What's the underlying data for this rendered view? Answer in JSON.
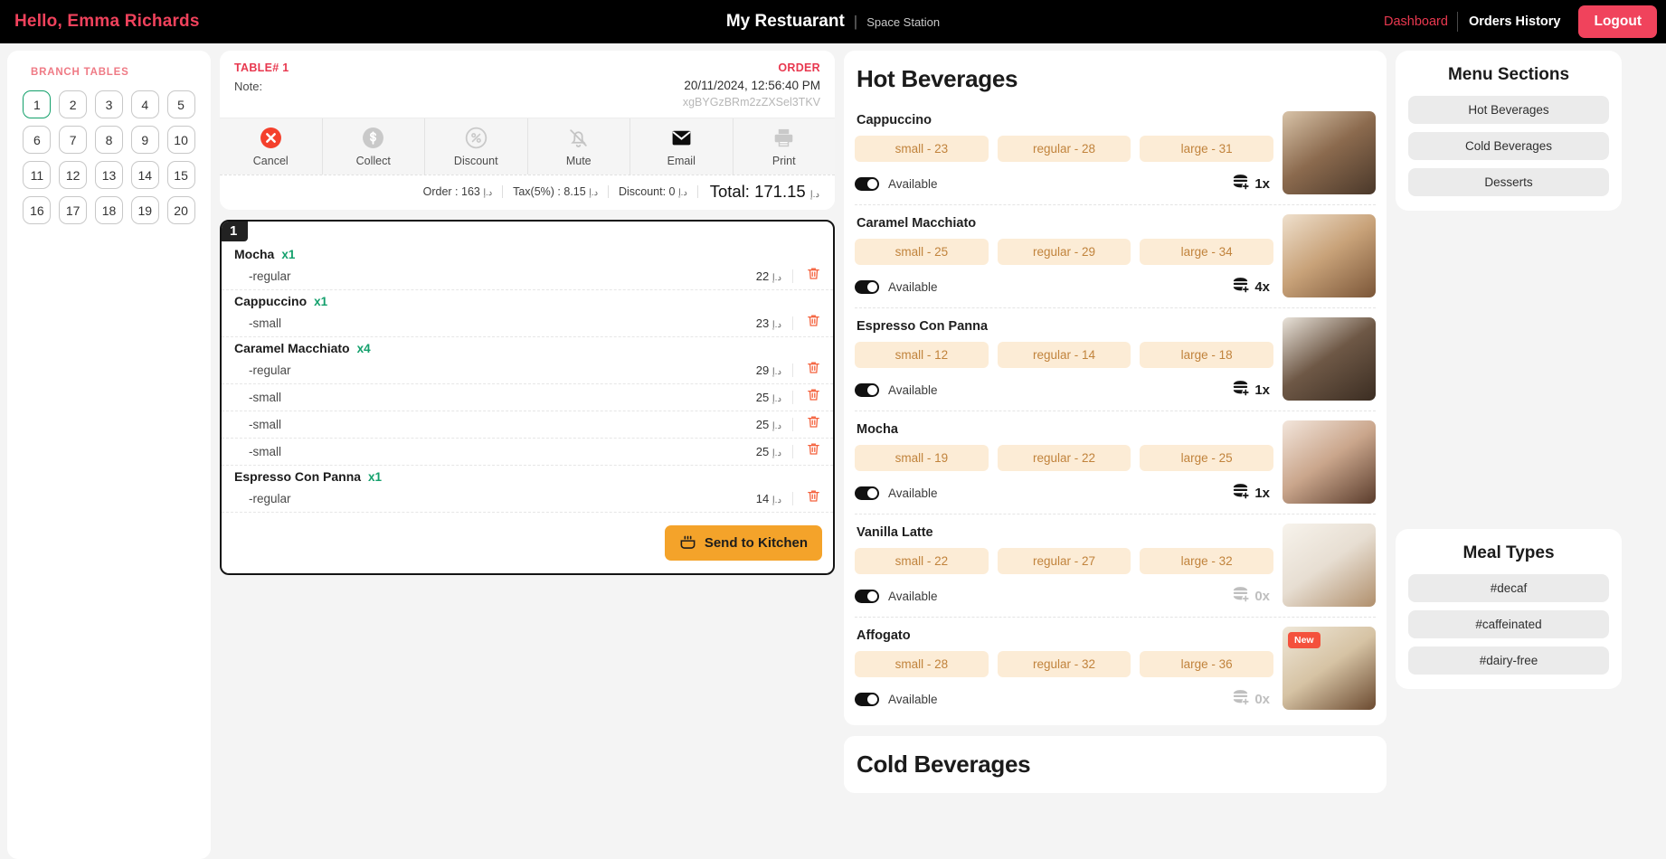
{
  "header": {
    "greeting": "Hello, Emma Richards",
    "brand_name": "My Restuarant",
    "brand_separator": "|",
    "branch": "Space Station",
    "nav_dashboard": "Dashboard",
    "nav_orders_history": "Orders History",
    "logout": "Logout",
    "accent_red": "#f0435c",
    "bar_background": "#000000"
  },
  "branch_tables": {
    "title": "BRANCH TABLES",
    "active_table": "1",
    "tables": [
      "1",
      "2",
      "3",
      "4",
      "5",
      "6",
      "7",
      "8",
      "9",
      "10",
      "11",
      "12",
      "13",
      "14",
      "15",
      "16",
      "17",
      "18",
      "19",
      "20"
    ],
    "active_border_color": "#12a06a"
  },
  "order": {
    "table_label": "TABLE# 1",
    "note_label": "Note:",
    "order_label": "ORDER",
    "datetime": "20/11/2024, 12:56:40 PM",
    "order_id": "xgBYGzBRm2zZXSel3TKV",
    "toolbar": [
      {
        "label": "Cancel",
        "icon": "cancel-circle-icon"
      },
      {
        "label": "Collect",
        "icon": "dollar-circle-icon"
      },
      {
        "label": "Discount",
        "icon": "percent-circle-icon"
      },
      {
        "label": "Mute",
        "icon": "bell-off-icon"
      },
      {
        "label": "Email",
        "icon": "envelope-icon"
      },
      {
        "label": "Print",
        "icon": "printer-icon"
      }
    ],
    "totals": {
      "order": "Order : 163",
      "tax": "Tax(5%) : 8.15",
      "discount": "Discount: 0",
      "total": "Total: 171.15",
      "currency": "د.إ"
    }
  },
  "ticket": {
    "number": "1",
    "send_button": "Send to Kitchen",
    "currency": "د.إ",
    "groups": [
      {
        "name": "Mocha",
        "qty": "x1",
        "options": [
          {
            "name": "-regular",
            "price": "22"
          }
        ]
      },
      {
        "name": "Cappuccino",
        "qty": "x1",
        "options": [
          {
            "name": "-small",
            "price": "23"
          }
        ]
      },
      {
        "name": "Caramel Macchiato",
        "qty": "x4",
        "options": [
          {
            "name": "-regular",
            "price": "29"
          },
          {
            "name": "-small",
            "price": "25"
          },
          {
            "name": "-small",
            "price": "25"
          },
          {
            "name": "-small",
            "price": "25"
          }
        ]
      },
      {
        "name": "Espresso Con Panna",
        "qty": "x1",
        "options": [
          {
            "name": "-regular",
            "price": "14"
          }
        ]
      }
    ]
  },
  "menu": {
    "sections": [
      {
        "title": "Hot Beverages",
        "items": [
          {
            "name": "Cappuccino",
            "sizes": [
              "small - 23",
              "regular - 28",
              "large - 31"
            ],
            "available_label": "Available",
            "available": true,
            "count": "1x",
            "new": false,
            "thumb_colors": [
              "#8b6a4e",
              "#d8c3a8",
              "#4a382a"
            ]
          },
          {
            "name": "Caramel Macchiato",
            "sizes": [
              "small - 25",
              "regular - 29",
              "large - 34"
            ],
            "available_label": "Available",
            "available": true,
            "count": "4x",
            "new": false,
            "thumb_colors": [
              "#c8a279",
              "#efe0cd",
              "#7b5638"
            ]
          },
          {
            "name": "Espresso Con Panna",
            "sizes": [
              "small - 12",
              "regular - 14",
              "large - 18"
            ],
            "available_label": "Available",
            "available": true,
            "count": "1x",
            "new": false,
            "thumb_colors": [
              "#6e5846",
              "#e9e3da",
              "#3b2d22"
            ]
          },
          {
            "name": "Mocha",
            "sizes": [
              "small - 19",
              "regular - 22",
              "large - 25"
            ],
            "available_label": "Available",
            "available": true,
            "count": "1x",
            "new": false,
            "thumb_colors": [
              "#caa68c",
              "#f3e6dc",
              "#5a3c2c"
            ]
          },
          {
            "name": "Vanilla Latte",
            "sizes": [
              "small - 22",
              "regular - 27",
              "large - 32"
            ],
            "available_label": "Available",
            "available": true,
            "count": "0x",
            "new": false,
            "thumb_colors": [
              "#e7ded2",
              "#f7f3ec",
              "#b08f6c"
            ]
          },
          {
            "name": "Affogato",
            "sizes": [
              "small - 28",
              "regular - 32",
              "large - 36"
            ],
            "available_label": "Available",
            "available": true,
            "count": "0x",
            "new": true,
            "new_badge": "New",
            "thumb_colors": [
              "#d6c3a4",
              "#efe7d8",
              "#6b4a30"
            ]
          }
        ]
      },
      {
        "title": "Cold Beverages",
        "items": []
      }
    ]
  },
  "right_sidebar": {
    "menu_sections_title": "Menu Sections",
    "menu_sections": [
      "Hot Beverages",
      "Cold Beverages",
      "Desserts"
    ],
    "meal_types_title": "Meal Types",
    "meal_types": [
      "#decaf",
      "#caffeinated",
      "#dairy-free"
    ]
  }
}
